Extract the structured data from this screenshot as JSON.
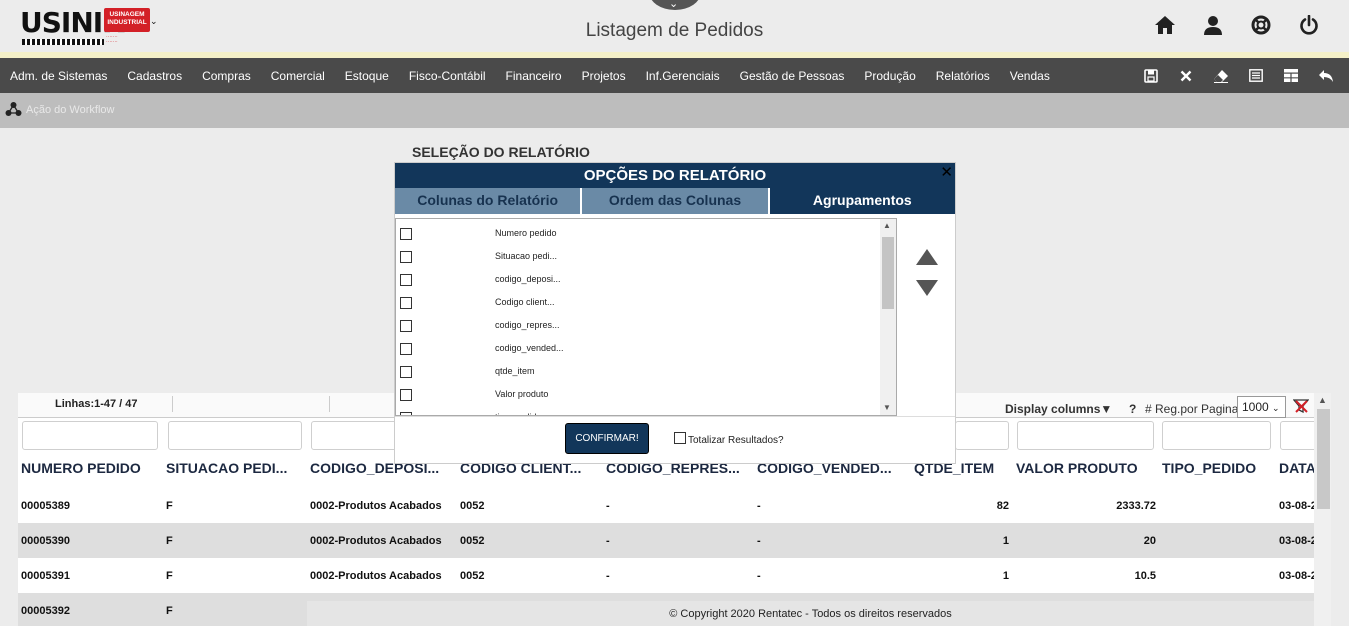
{
  "app": {
    "logo_text": "USINIK",
    "logo_badge": "USINAGEM INDUSTRIAL",
    "page_title": "Listagem de Pedidos"
  },
  "header_icons": [
    "home-icon",
    "user-icon",
    "lifebuoy-icon",
    "power-icon"
  ],
  "menu": [
    "Adm. de Sistemas",
    "Cadastros",
    "Compras",
    "Comercial",
    "Estoque",
    "Fisco-Contábil",
    "Financeiro",
    "Projetos",
    "Inf.Gerenciais",
    "Gestão de Pessoas",
    "Produção",
    "Relatórios",
    "Vendas"
  ],
  "toolbar_icons": [
    "save-icon",
    "close-icon",
    "eraser-icon",
    "list-icon",
    "grid-icon",
    "undo-icon"
  ],
  "workflow": {
    "label": "Ação do Workflow"
  },
  "report_selection_title": "SELEÇÃO DO RELATÓRIO",
  "grid": {
    "lines_count": "Linhas:1-47 / 47",
    "display_columns": "Display columns▼",
    "help": "?",
    "reg_label": "# Reg.por Pagina",
    "reg_value": "1000",
    "columns": [
      "NUMERO PEDIDO",
      "SITUACAO PEDI...",
      "CODIGO_DEPOSI...",
      "CODIGO CLIENT...",
      "CODIGO_REPRES...",
      "CODIGO_VENDED...",
      "QTDE_ITEM",
      "VALOR PRODUTO",
      "TIPO_PEDIDO",
      "DATA"
    ],
    "rows": [
      [
        "00005389",
        "F",
        "0002-Produtos Acabados",
        "0052",
        "-",
        "-",
        "82",
        "2333.72",
        "",
        "03-08-2"
      ],
      [
        "00005390",
        "F",
        "0002-Produtos Acabados",
        "0052",
        "-",
        "-",
        "1",
        "20",
        "",
        "03-08-2"
      ],
      [
        "00005391",
        "F",
        "0002-Produtos Acabados",
        "0052",
        "-",
        "-",
        "1",
        "10.5",
        "",
        "03-08-2"
      ],
      [
        "00005392",
        "F",
        "",
        "",
        "",
        "",
        "",
        "",
        "",
        ""
      ]
    ]
  },
  "modal": {
    "title": "OPÇÕES DO RELATÓRIO",
    "close": "✕",
    "tabs": [
      "Colunas do Relatório",
      "Ordem das Colunas",
      "Agrupamentos"
    ],
    "active_tab": "Agrupamentos",
    "items": [
      "Numero pedido",
      "Situacao pedi...",
      "codigo_deposi...",
      "Codigo client...",
      "codigo_repres...",
      "codigo_vended...",
      "qtde_item",
      "Valor produto",
      "tipo_pedido"
    ],
    "confirm": "CONFIRMAR!",
    "total_label": "Totalizar Resultados?"
  },
  "footer": "© Copyright 2020 Rentatec - Todos os direitos reservados",
  "colors": {
    "navy": "#12365a",
    "menubar": "#4a4a4a",
    "tab_inactive": "#6a8aa6",
    "brand_red": "#d32027"
  }
}
